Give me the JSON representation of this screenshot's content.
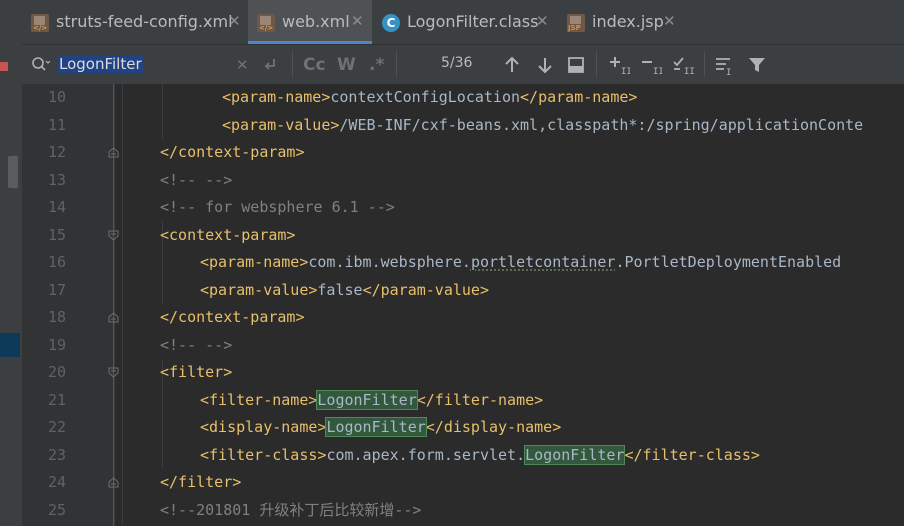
{
  "tabs": [
    {
      "label": "struts-feed-config.xml",
      "icon": "xml-file-icon",
      "active": false
    },
    {
      "label": "web.xml",
      "icon": "xml-file-icon",
      "active": true
    },
    {
      "label": "LogonFilter.class",
      "icon": "class-file-icon",
      "active": false
    },
    {
      "label": "index.jsp",
      "icon": "jsp-file-icon",
      "active": false
    }
  ],
  "close_glyph": "✕",
  "find": {
    "query": "LogonFilter",
    "match_count": "5/36",
    "opt_case": "Cc",
    "opt_words": "W",
    "opt_regex": ".*"
  },
  "colors": {
    "tag": "#e8bf6a",
    "text": "#a9b7c6",
    "comment": "#808080",
    "match_bg": "#32593d",
    "active_tab_underline": "#4a88c7"
  },
  "editor": {
    "lines": [
      {
        "num": "10",
        "tokens": [
          [
            "tag",
            "<param-name>"
          ],
          [
            "txt",
            "contextConfigLocation"
          ],
          [
            "tag",
            "</param-name>"
          ]
        ]
      },
      {
        "num": "11",
        "tokens": [
          [
            "tag",
            "<param-value>"
          ],
          [
            "txt",
            "/WEB-INF/cxf-beans.xml,classpath*:/spring/applicationConte"
          ]
        ]
      },
      {
        "num": "12",
        "tokens": [
          [
            "tag",
            "</context-param>"
          ]
        ]
      },
      {
        "num": "13",
        "tokens": [
          [
            "cmt",
            "<!-- -->"
          ]
        ]
      },
      {
        "num": "14",
        "tokens": [
          [
            "cmt",
            "<!-- for websphere 6.1 -->"
          ]
        ]
      },
      {
        "num": "15",
        "tokens": [
          [
            "tag",
            "<context-param>"
          ]
        ]
      },
      {
        "num": "16",
        "tokens": [
          [
            "tag",
            "<param-name>"
          ],
          [
            "txt",
            "com.ibm.websphere."
          ],
          [
            "wavy",
            "portletcontainer"
          ],
          [
            "txt",
            "."
          ],
          [
            "txt",
            "PortletDeploymentEnabled"
          ]
        ]
      },
      {
        "num": "17",
        "tokens": [
          [
            "tag",
            "<param-value>"
          ],
          [
            "txt",
            "false"
          ],
          [
            "tag",
            "</param-value>"
          ]
        ]
      },
      {
        "num": "18",
        "tokens": [
          [
            "tag",
            "</context-param>"
          ]
        ]
      },
      {
        "num": "19",
        "tokens": [
          [
            "cmt",
            "<!-- -->"
          ]
        ]
      },
      {
        "num": "20",
        "tokens": [
          [
            "tag",
            "<filter>"
          ]
        ]
      },
      {
        "num": "21",
        "tokens": [
          [
            "tag",
            "<filter-name>"
          ],
          [
            "hl",
            "LogonFilter"
          ],
          [
            "tag",
            "</filter-name>"
          ]
        ]
      },
      {
        "num": "22",
        "tokens": [
          [
            "tag",
            "<display-name>"
          ],
          [
            "hl",
            "LogonFilter"
          ],
          [
            "tag",
            "</display-name>"
          ]
        ]
      },
      {
        "num": "23",
        "tokens": [
          [
            "tag",
            "<filter-class>"
          ],
          [
            "txt",
            "com.apex.form.servlet."
          ],
          [
            "hl",
            "LogonFilter"
          ],
          [
            "tag",
            "</filter-class>"
          ]
        ]
      },
      {
        "num": "24",
        "tokens": [
          [
            "tag",
            "</filter>"
          ]
        ]
      },
      {
        "num": "25",
        "tokens": [
          [
            "cmt",
            "<!--201801 升级补丁后比较新增-->"
          ]
        ]
      }
    ]
  }
}
